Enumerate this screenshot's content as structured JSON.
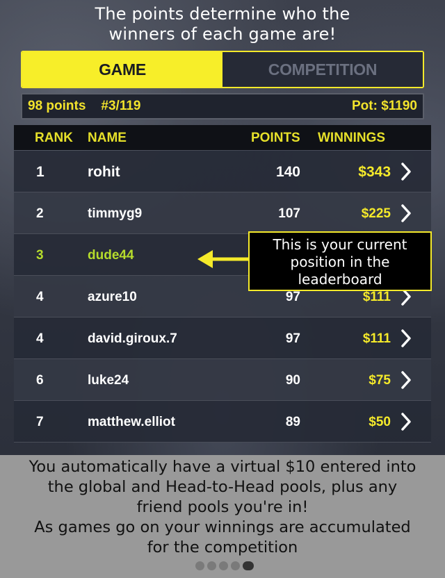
{
  "headline": {
    "line1": "The points determine who the",
    "line2": "winners of each game are!"
  },
  "tabs": [
    {
      "label": "GAME",
      "active": true
    },
    {
      "label": "COMPETITION",
      "active": false
    }
  ],
  "status": {
    "points": "98 points",
    "rank": "#3/119",
    "pot": "Pot: $1190"
  },
  "table": {
    "headers": {
      "rank": "RANK",
      "name": "NAME",
      "points": "POINTS",
      "winnings": "WINNINGS"
    },
    "rows": [
      {
        "rank": "1",
        "name": "rohit",
        "points": "140",
        "winnings": "$343"
      },
      {
        "rank": "2",
        "name": "timmyg9",
        "points": "107",
        "winnings": "$225"
      },
      {
        "rank": "3",
        "name": "dude44",
        "points": "",
        "winnings": ""
      },
      {
        "rank": "4",
        "name": "azure10",
        "points": "97",
        "winnings": "$111"
      },
      {
        "rank": "4",
        "name": "david.giroux.7",
        "points": "97",
        "winnings": "$111"
      },
      {
        "rank": "6",
        "name": "luke24",
        "points": "90",
        "winnings": "$75"
      },
      {
        "rank": "7",
        "name": "matthew.elliot",
        "points": "89",
        "winnings": "$50"
      }
    ]
  },
  "tooltip": {
    "line1": "This is your current",
    "line2": "position in the",
    "line3": "leaderboard"
  },
  "footer": {
    "line1": "You automatically have a virtual $10 entered into",
    "line2": "the global and Head-to-Head pools, plus any",
    "line3": "friend pools you're in!",
    "line4": "As games go on your winnings are accumulated",
    "line5": "for the competition"
  },
  "pager": {
    "total": 5,
    "current": 5
  },
  "colors": {
    "accent": "#f5ea2a",
    "highlight": "#b6dc2c",
    "footer_bg": "#999999"
  }
}
